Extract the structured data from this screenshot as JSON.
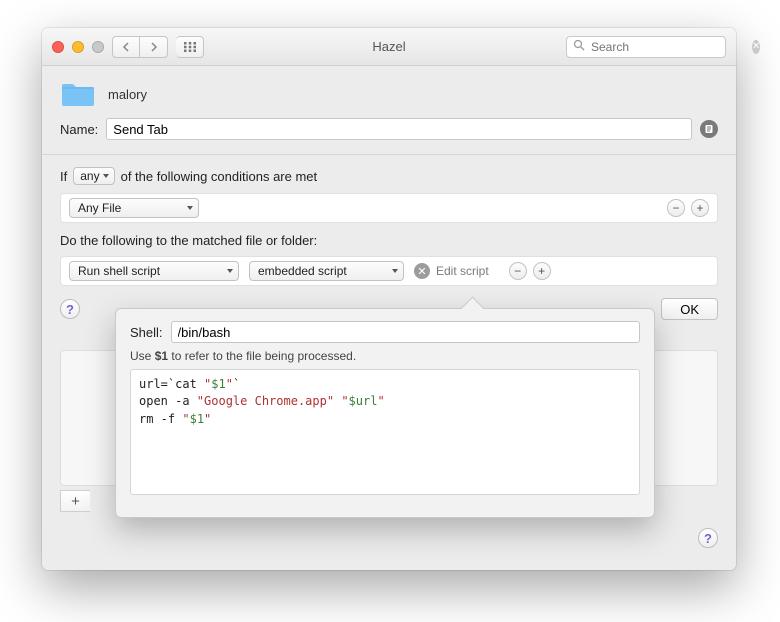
{
  "window": {
    "title": "Hazel",
    "search_placeholder": "Search"
  },
  "folder": {
    "name": "malory"
  },
  "rule": {
    "name_label": "Name:",
    "name_value": "Send Tab"
  },
  "conditions": {
    "prefix": "If",
    "quantifier": "any",
    "suffix": "of the following conditions are met",
    "rows": [
      {
        "subject": "Any File"
      }
    ]
  },
  "actions": {
    "heading": "Do the following to the matched file or folder:",
    "rows": [
      {
        "verb": "Run shell script",
        "target": "embedded script",
        "edit_label": "Edit script"
      }
    ]
  },
  "buttons": {
    "ok": "OK"
  },
  "popover": {
    "shell_label": "Shell:",
    "shell_value": "/bin/bash",
    "hint_prefix": "Use ",
    "hint_token": "$1",
    "hint_suffix": " to refer to the file being processed.",
    "script_lines": [
      {
        "raw": "url=`cat \"$1\"`"
      },
      {
        "raw": "open -a \"Google Chrome.app\" \"$url\""
      },
      {
        "raw": "rm -f \"$1\""
      }
    ]
  }
}
